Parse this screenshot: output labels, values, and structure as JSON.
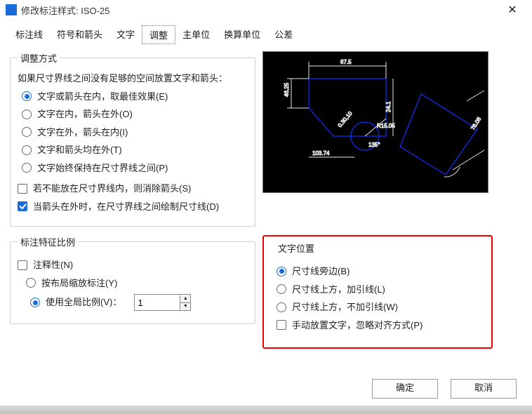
{
  "title": "修改标注样式: ISO-25",
  "tabs": [
    "标注线",
    "符号和箭头",
    "文字",
    "调整",
    "主单位",
    "换算单位",
    "公差"
  ],
  "active_tab": "调整",
  "fit_method": {
    "legend": "调整方式",
    "intro": "如果尺寸界线之间没有足够的空间放置文字和箭头：",
    "opts": [
      "文字或箭头在内，取最佳效果(E)",
      "文字在内，箭头在外(O)",
      "文字在外，箭头在内(I)",
      "文字和箭头均在外(T)",
      "文字始终保持在尺寸界线之间(P)"
    ],
    "chk_suppress": "若不能放在尺寸界线内，则消除箭头(S)",
    "chk_drawdim": "当箭头在外时，在尺寸界线之间绘制尺寸线(D)"
  },
  "scale": {
    "legend": "标注特征比例",
    "chk_annotative": "注释性(N)",
    "opt_layout": "按布局缩放标注(Y)",
    "opt_global": "使用全局比例(V)：",
    "global_value": "1"
  },
  "text_pos": {
    "legend": "文字位置",
    "opts": [
      "尺寸线旁边(B)",
      "尺寸线上方，加引线(L)",
      "尺寸线上方，不加引线(W)"
    ],
    "chk_manual": "手动放置文字，忽略对齐方式(P)"
  },
  "footer": {
    "ok": "确定",
    "cancel": "取消"
  },
  "preview_labels": {
    "d1": "87.5",
    "d2": "46.25",
    "d3": "24.1",
    "d4": "76.08",
    "d5": "103.74",
    "r": "R15.05",
    "ang": "135°",
    "sa": "0.30,10"
  }
}
